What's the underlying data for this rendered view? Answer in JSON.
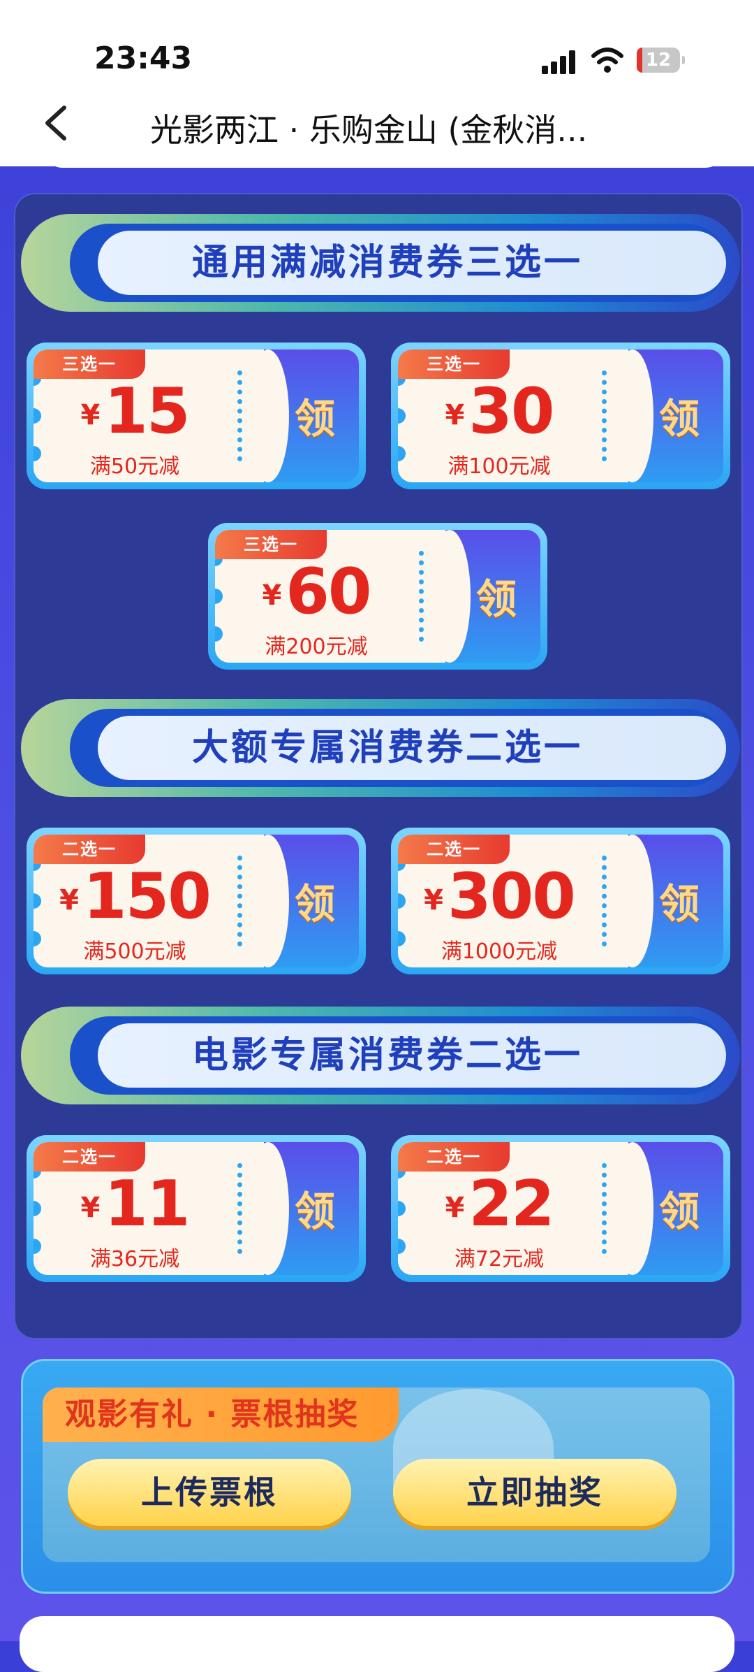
{
  "status_bar": {
    "time": "23:43",
    "battery": "12"
  },
  "nav": {
    "title": "光影两江 · 乐购金山 (金秋消..."
  },
  "sections": [
    {
      "title": "通用满减消费券三选一",
      "coupons": [
        {
          "tag": "三选一",
          "currency": "¥",
          "amount": "15",
          "condition": "满50元减",
          "action": "领"
        },
        {
          "tag": "三选一",
          "currency": "¥",
          "amount": "30",
          "condition": "满100元减",
          "action": "领"
        },
        {
          "tag": "三选一",
          "currency": "¥",
          "amount": "60",
          "condition": "满200元减",
          "action": "领"
        }
      ]
    },
    {
      "title": "大额专属消费券二选一",
      "coupons": [
        {
          "tag": "二选一",
          "currency": "¥",
          "amount": "150",
          "condition": "满500元减",
          "action": "领"
        },
        {
          "tag": "二选一",
          "currency": "¥",
          "amount": "300",
          "condition": "满1000元减",
          "action": "领"
        }
      ]
    },
    {
      "title": "电影专属消费券二选一",
      "coupons": [
        {
          "tag": "二选一",
          "currency": "¥",
          "amount": "11",
          "condition": "满36元减",
          "action": "领"
        },
        {
          "tag": "二选一",
          "currency": "¥",
          "amount": "22",
          "condition": "满72元减",
          "action": "领"
        }
      ]
    }
  ],
  "lottery": {
    "heading": "观影有礼 · 票根抽奖",
    "upload_label": "上传票根",
    "draw_label": "立即抽奖"
  },
  "colors": {
    "accent_red": "#e4271e",
    "panel_bg": "#2d3a96",
    "button_gold": "#ffd24a"
  }
}
